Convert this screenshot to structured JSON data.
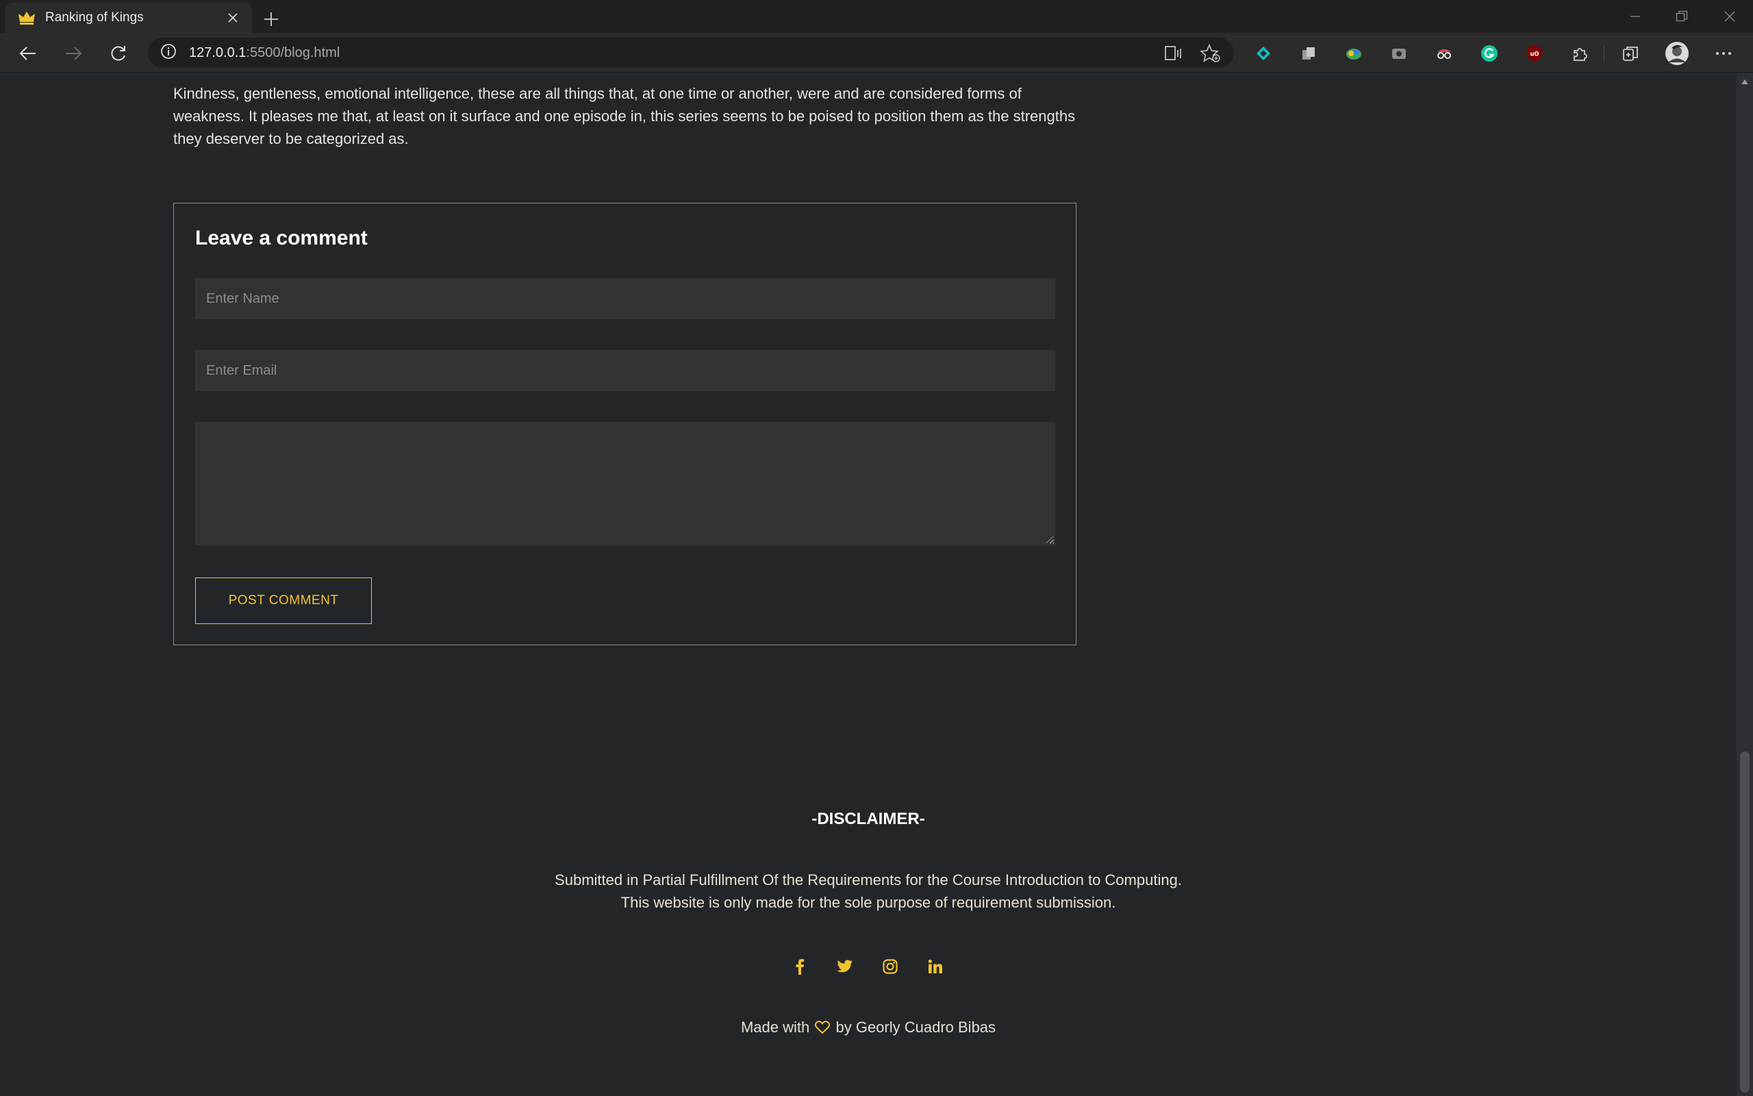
{
  "browser": {
    "tab_title": "Ranking of Kings",
    "url_host": "127.0.0.1",
    "url_rest": ":5500/blog.html"
  },
  "article": {
    "text": "Kindness, gentleness, emotional intelligence, these are all things that, at one time or another, were and are considered forms of weakness. It pleases me that, at least on it surface and one episode in, this series seems to be poised to position them as the strengths they deserver to be categorized as."
  },
  "comment_form": {
    "title": "Leave a comment",
    "name_placeholder": "Enter Name",
    "email_placeholder": "Enter Email",
    "message_value": "",
    "post_label": "POST COMMENT"
  },
  "footer": {
    "disclaimer_title": "-DISCLAIMER-",
    "disclaimer_line1": "Submitted in Partial Fulfillment Of the Requirements for the Course Introduction to Computing.",
    "disclaimer_line2": "This website is only made for the sole purpose of requirement submission.",
    "made_with_prefix": "Made with",
    "made_with_suffix": "by Georly Cuadro Bibas",
    "socials": [
      "facebook-icon",
      "twitter-icon",
      "instagram-icon",
      "linkedin-icon"
    ]
  },
  "colors": {
    "background": "#232629",
    "accent": "#f2c230",
    "field": "#2f3336",
    "border": "#8d8d8d"
  }
}
